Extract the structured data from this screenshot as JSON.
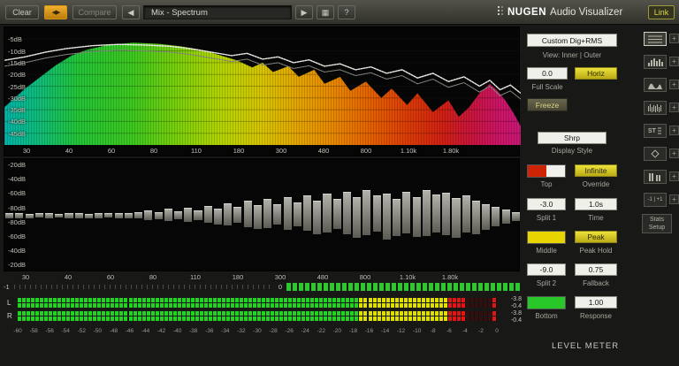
{
  "toolbar": {
    "clear": "Clear",
    "swap_glyph": "◀▶",
    "compare": "Compare",
    "prev_glyph": "◀",
    "preset": "Mix - Spectrum",
    "play_glyph": "▶",
    "grid_glyph": "▦",
    "help_glyph": "?",
    "brand_name": "NUGEN",
    "brand_suffix": "Audio Visualizer",
    "link": "Link"
  },
  "freq_labels": [
    "30",
    "40",
    "60",
    "80",
    "110",
    "180",
    "300",
    "480",
    "800",
    "1.10k",
    "1.80k"
  ],
  "spectrum": {
    "y_labels": [
      "-5dB",
      "-10dB",
      "-15dB",
      "-20dB",
      "-25dB",
      "-30dB",
      "-35dB",
      "-40dB",
      "-45dB"
    ],
    "gradient": [
      [
        "0%",
        "#00b4a8"
      ],
      [
        "7%",
        "#10bc78"
      ],
      [
        "14%",
        "#22c438"
      ],
      [
        "25%",
        "#3ec81e"
      ],
      [
        "34%",
        "#7ed00a"
      ],
      [
        "42%",
        "#b4d400"
      ],
      [
        "50%",
        "#d8c400"
      ],
      [
        "57%",
        "#e4a400"
      ],
      [
        "64%",
        "#e88600"
      ],
      [
        "71%",
        "#e46000"
      ],
      [
        "78%",
        "#dc3c06"
      ],
      [
        "85%",
        "#d02014"
      ],
      [
        "91%",
        "#c81440"
      ],
      [
        "96%",
        "#cc1468"
      ],
      [
        "100%",
        "#c81874"
      ]
    ],
    "fill_points": [
      [
        0,
        -34
      ],
      [
        0.02,
        -30
      ],
      [
        0.04,
        -26
      ],
      [
        0.07,
        -21
      ],
      [
        0.1,
        -16
      ],
      [
        0.13,
        -12
      ],
      [
        0.16,
        -9.5
      ],
      [
        0.2,
        -7.5
      ],
      [
        0.25,
        -6.5
      ],
      [
        0.3,
        -7
      ],
      [
        0.34,
        -8
      ],
      [
        0.38,
        -9.5
      ],
      [
        0.42,
        -12
      ],
      [
        0.45,
        -14
      ],
      [
        0.48,
        -17
      ],
      [
        0.5,
        -15
      ],
      [
        0.52,
        -19
      ],
      [
        0.55,
        -16.5
      ],
      [
        0.57,
        -21
      ],
      [
        0.6,
        -18
      ],
      [
        0.62,
        -24
      ],
      [
        0.65,
        -21
      ],
      [
        0.67,
        -27
      ],
      [
        0.7,
        -23
      ],
      [
        0.73,
        -30
      ],
      [
        0.75,
        -26
      ],
      [
        0.78,
        -33
      ],
      [
        0.8,
        -28
      ],
      [
        0.83,
        -36
      ],
      [
        0.86,
        -31
      ],
      [
        0.88,
        -38
      ],
      [
        0.9,
        -34
      ],
      [
        0.92,
        -28
      ],
      [
        0.94,
        -24
      ],
      [
        0.955,
        -27
      ],
      [
        0.97,
        -31
      ],
      [
        0.985,
        -36
      ],
      [
        1,
        -42
      ]
    ],
    "line_points": [
      [
        0,
        -14
      ],
      [
        0.04,
        -12.5
      ],
      [
        0.08,
        -10.5
      ],
      [
        0.12,
        -9
      ],
      [
        0.17,
        -7.8
      ],
      [
        0.22,
        -7.2
      ],
      [
        0.27,
        -7.5
      ],
      [
        0.32,
        -8
      ],
      [
        0.36,
        -9
      ],
      [
        0.4,
        -10.5
      ],
      [
        0.44,
        -12
      ],
      [
        0.47,
        -11
      ],
      [
        0.5,
        -13.5
      ],
      [
        0.53,
        -12.5
      ],
      [
        0.56,
        -15
      ],
      [
        0.59,
        -13.8
      ],
      [
        0.62,
        -16.5
      ],
      [
        0.65,
        -15.5
      ],
      [
        0.68,
        -18
      ],
      [
        0.71,
        -16.8
      ],
      [
        0.74,
        -19.5
      ],
      [
        0.77,
        -18
      ],
      [
        0.8,
        -21.5
      ],
      [
        0.83,
        -19.5
      ],
      [
        0.86,
        -23
      ],
      [
        0.89,
        -21
      ],
      [
        0.92,
        -25
      ],
      [
        0.94,
        -22.5
      ],
      [
        0.96,
        -26.5
      ],
      [
        0.98,
        -24.5
      ],
      [
        1,
        -28
      ]
    ]
  },
  "diff": {
    "y_labels": [
      "-20dB",
      "-40dB",
      "-60dB",
      "-80dB",
      "-80dB",
      "-60dB",
      "-40dB",
      "-20dB"
    ],
    "bars": [
      [
        3,
        3
      ],
      [
        3,
        3
      ],
      [
        2,
        3
      ],
      [
        3,
        2
      ],
      [
        3,
        3
      ],
      [
        2,
        2
      ],
      [
        3,
        3
      ],
      [
        3,
        3
      ],
      [
        2,
        3
      ],
      [
        3,
        3
      ],
      [
        3,
        2
      ],
      [
        3,
        3
      ],
      [
        3,
        3
      ],
      [
        4,
        3
      ],
      [
        6,
        5
      ],
      [
        4,
        4
      ],
      [
        8,
        6
      ],
      [
        5,
        4
      ],
      [
        9,
        7
      ],
      [
        6,
        5
      ],
      [
        11,
        8
      ],
      [
        8,
        10
      ],
      [
        14,
        11
      ],
      [
        10,
        8
      ],
      [
        17,
        13
      ],
      [
        12,
        15
      ],
      [
        19,
        14
      ],
      [
        13,
        10
      ],
      [
        21,
        16
      ],
      [
        15,
        12
      ],
      [
        23,
        17
      ],
      [
        17,
        21
      ],
      [
        25,
        19
      ],
      [
        19,
        15
      ],
      [
        27,
        21
      ],
      [
        21,
        25
      ],
      [
        29,
        22
      ],
      [
        23,
        18
      ],
      [
        25,
        27
      ],
      [
        19,
        23
      ],
      [
        27,
        20
      ],
      [
        21,
        24
      ],
      [
        29,
        23
      ],
      [
        24,
        19
      ],
      [
        26,
        22
      ],
      [
        20,
        25
      ],
      [
        23,
        19
      ],
      [
        17,
        21
      ],
      [
        13,
        16
      ],
      [
        10,
        12
      ],
      [
        7,
        9
      ],
      [
        4,
        6
      ]
    ]
  },
  "correlation": {
    "neg_label": "-1",
    "zero_label": "0",
    "segments": 38,
    "color": "#2cc82c"
  },
  "meter": {
    "channels": [
      {
        "label": "L",
        "rows": [
          -3.8,
          -3.8
        ],
        "peak": -0.4,
        "readouts": [
          "-3.8",
          "-0.4"
        ]
      },
      {
        "label": "R",
        "rows": [
          -3.8,
          -3.8
        ],
        "peak": -0.4,
        "readouts": [
          "-3.8",
          "-0.4"
        ]
      }
    ],
    "scale": [
      "-60",
      "-58",
      "-56",
      "-54",
      "-52",
      "-50",
      "-48",
      "-46",
      "-44",
      "-42",
      "-40",
      "-38",
      "-36",
      "-34",
      "-32",
      "-30",
      "-28",
      "-26",
      "-24",
      "-22",
      "-20",
      "-18",
      "-16",
      "-14",
      "-12",
      "-10",
      "-8",
      "-6",
      "-4",
      "-2",
      "0"
    ],
    "db_range": 60,
    "zones": {
      "yellow_from": -17,
      "red_from": -6
    }
  },
  "controls": {
    "mode": "Custom Dig+RMS",
    "view_caption": "View: Inner | Outer",
    "full_scale_value": "0.0",
    "horiz": "Horiz",
    "full_scale_label": "Full Scale",
    "freeze": "Freeze",
    "display_style_value": "Shrp",
    "display_style_label": "Display Style",
    "infinite": "Infinite",
    "top_label": "Top",
    "override_label": "Override",
    "split1_value": "-3.0",
    "time_value": "1.0s",
    "split1_label": "Split 1",
    "time_label": "Time",
    "peak": "Peak",
    "middle_label": "Middle",
    "peak_hold_label": "Peak Hold",
    "split2_value": "-9.0",
    "fallback_value": "0.75",
    "split2_label": "Split 2",
    "fallback_label": "Fallback",
    "response_value": "1.00",
    "bottom_label": "Bottom",
    "response_label": "Response",
    "level_meter_label": "LEVEL METER",
    "swatches": {
      "top_left": "#cc2404",
      "top_right": "#f0f0ec",
      "middle": "#e8d400",
      "bottom": "#28c828"
    }
  },
  "icon_strip": {
    "plus": "+",
    "items": [
      {
        "name": "spectrum-view",
        "glyph": "lines",
        "active": true
      },
      {
        "name": "histogram-view",
        "glyph": "bars"
      },
      {
        "name": "spectrogram-view",
        "glyph": "curve"
      },
      {
        "name": "waveform-view",
        "glyph": "hatch"
      },
      {
        "name": "stereo-spectrum-view",
        "glyph": "st",
        "label": "ST"
      },
      {
        "name": "vectorscope-view",
        "glyph": "diamond"
      },
      {
        "name": "level-meter-view",
        "glyph": "meter"
      },
      {
        "name": "correlation-view",
        "glyph": "corr",
        "label": "-1 | +1"
      }
    ],
    "stats_setup": "Stats\nSetup"
  }
}
